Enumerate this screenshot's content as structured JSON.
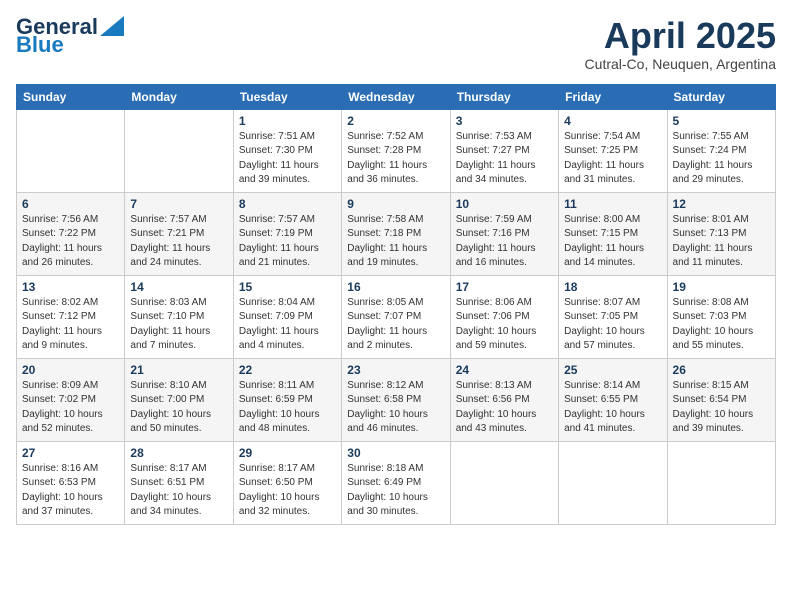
{
  "header": {
    "logo": {
      "general": "General",
      "blue": "Blue",
      "tagline": ""
    },
    "title": "April 2025",
    "subtitle": "Cutral-Co, Neuquen, Argentina"
  },
  "weekdays": [
    "Sunday",
    "Monday",
    "Tuesday",
    "Wednesday",
    "Thursday",
    "Friday",
    "Saturday"
  ],
  "weeks": [
    [
      {
        "day": "",
        "sunrise": "",
        "sunset": "",
        "daylight": ""
      },
      {
        "day": "",
        "sunrise": "",
        "sunset": "",
        "daylight": ""
      },
      {
        "day": "1",
        "sunrise": "Sunrise: 7:51 AM",
        "sunset": "Sunset: 7:30 PM",
        "daylight": "Daylight: 11 hours and 39 minutes."
      },
      {
        "day": "2",
        "sunrise": "Sunrise: 7:52 AM",
        "sunset": "Sunset: 7:28 PM",
        "daylight": "Daylight: 11 hours and 36 minutes."
      },
      {
        "day": "3",
        "sunrise": "Sunrise: 7:53 AM",
        "sunset": "Sunset: 7:27 PM",
        "daylight": "Daylight: 11 hours and 34 minutes."
      },
      {
        "day": "4",
        "sunrise": "Sunrise: 7:54 AM",
        "sunset": "Sunset: 7:25 PM",
        "daylight": "Daylight: 11 hours and 31 minutes."
      },
      {
        "day": "5",
        "sunrise": "Sunrise: 7:55 AM",
        "sunset": "Sunset: 7:24 PM",
        "daylight": "Daylight: 11 hours and 29 minutes."
      }
    ],
    [
      {
        "day": "6",
        "sunrise": "Sunrise: 7:56 AM",
        "sunset": "Sunset: 7:22 PM",
        "daylight": "Daylight: 11 hours and 26 minutes."
      },
      {
        "day": "7",
        "sunrise": "Sunrise: 7:57 AM",
        "sunset": "Sunset: 7:21 PM",
        "daylight": "Daylight: 11 hours and 24 minutes."
      },
      {
        "day": "8",
        "sunrise": "Sunrise: 7:57 AM",
        "sunset": "Sunset: 7:19 PM",
        "daylight": "Daylight: 11 hours and 21 minutes."
      },
      {
        "day": "9",
        "sunrise": "Sunrise: 7:58 AM",
        "sunset": "Sunset: 7:18 PM",
        "daylight": "Daylight: 11 hours and 19 minutes."
      },
      {
        "day": "10",
        "sunrise": "Sunrise: 7:59 AM",
        "sunset": "Sunset: 7:16 PM",
        "daylight": "Daylight: 11 hours and 16 minutes."
      },
      {
        "day": "11",
        "sunrise": "Sunrise: 8:00 AM",
        "sunset": "Sunset: 7:15 PM",
        "daylight": "Daylight: 11 hours and 14 minutes."
      },
      {
        "day": "12",
        "sunrise": "Sunrise: 8:01 AM",
        "sunset": "Sunset: 7:13 PM",
        "daylight": "Daylight: 11 hours and 11 minutes."
      }
    ],
    [
      {
        "day": "13",
        "sunrise": "Sunrise: 8:02 AM",
        "sunset": "Sunset: 7:12 PM",
        "daylight": "Daylight: 11 hours and 9 minutes."
      },
      {
        "day": "14",
        "sunrise": "Sunrise: 8:03 AM",
        "sunset": "Sunset: 7:10 PM",
        "daylight": "Daylight: 11 hours and 7 minutes."
      },
      {
        "day": "15",
        "sunrise": "Sunrise: 8:04 AM",
        "sunset": "Sunset: 7:09 PM",
        "daylight": "Daylight: 11 hours and 4 minutes."
      },
      {
        "day": "16",
        "sunrise": "Sunrise: 8:05 AM",
        "sunset": "Sunset: 7:07 PM",
        "daylight": "Daylight: 11 hours and 2 minutes."
      },
      {
        "day": "17",
        "sunrise": "Sunrise: 8:06 AM",
        "sunset": "Sunset: 7:06 PM",
        "daylight": "Daylight: 10 hours and 59 minutes."
      },
      {
        "day": "18",
        "sunrise": "Sunrise: 8:07 AM",
        "sunset": "Sunset: 7:05 PM",
        "daylight": "Daylight: 10 hours and 57 minutes."
      },
      {
        "day": "19",
        "sunrise": "Sunrise: 8:08 AM",
        "sunset": "Sunset: 7:03 PM",
        "daylight": "Daylight: 10 hours and 55 minutes."
      }
    ],
    [
      {
        "day": "20",
        "sunrise": "Sunrise: 8:09 AM",
        "sunset": "Sunset: 7:02 PM",
        "daylight": "Daylight: 10 hours and 52 minutes."
      },
      {
        "day": "21",
        "sunrise": "Sunrise: 8:10 AM",
        "sunset": "Sunset: 7:00 PM",
        "daylight": "Daylight: 10 hours and 50 minutes."
      },
      {
        "day": "22",
        "sunrise": "Sunrise: 8:11 AM",
        "sunset": "Sunset: 6:59 PM",
        "daylight": "Daylight: 10 hours and 48 minutes."
      },
      {
        "day": "23",
        "sunrise": "Sunrise: 8:12 AM",
        "sunset": "Sunset: 6:58 PM",
        "daylight": "Daylight: 10 hours and 46 minutes."
      },
      {
        "day": "24",
        "sunrise": "Sunrise: 8:13 AM",
        "sunset": "Sunset: 6:56 PM",
        "daylight": "Daylight: 10 hours and 43 minutes."
      },
      {
        "day": "25",
        "sunrise": "Sunrise: 8:14 AM",
        "sunset": "Sunset: 6:55 PM",
        "daylight": "Daylight: 10 hours and 41 minutes."
      },
      {
        "day": "26",
        "sunrise": "Sunrise: 8:15 AM",
        "sunset": "Sunset: 6:54 PM",
        "daylight": "Daylight: 10 hours and 39 minutes."
      }
    ],
    [
      {
        "day": "27",
        "sunrise": "Sunrise: 8:16 AM",
        "sunset": "Sunset: 6:53 PM",
        "daylight": "Daylight: 10 hours and 37 minutes."
      },
      {
        "day": "28",
        "sunrise": "Sunrise: 8:17 AM",
        "sunset": "Sunset: 6:51 PM",
        "daylight": "Daylight: 10 hours and 34 minutes."
      },
      {
        "day": "29",
        "sunrise": "Sunrise: 8:17 AM",
        "sunset": "Sunset: 6:50 PM",
        "daylight": "Daylight: 10 hours and 32 minutes."
      },
      {
        "day": "30",
        "sunrise": "Sunrise: 8:18 AM",
        "sunset": "Sunset: 6:49 PM",
        "daylight": "Daylight: 10 hours and 30 minutes."
      },
      {
        "day": "",
        "sunrise": "",
        "sunset": "",
        "daylight": ""
      },
      {
        "day": "",
        "sunrise": "",
        "sunset": "",
        "daylight": ""
      },
      {
        "day": "",
        "sunrise": "",
        "sunset": "",
        "daylight": ""
      }
    ]
  ]
}
